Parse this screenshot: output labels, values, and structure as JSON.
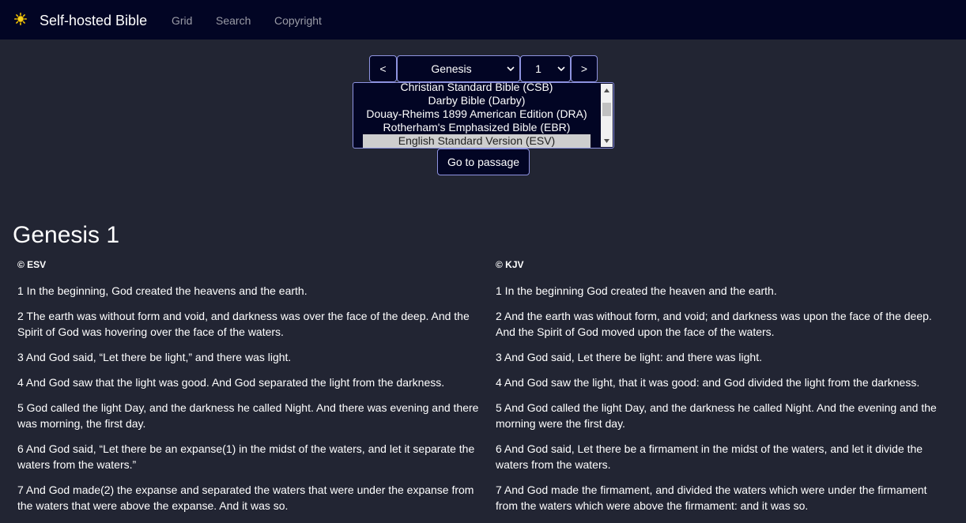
{
  "navbar": {
    "brand": "Self-hosted Bible",
    "brand_icon": "sun-icon",
    "links": [
      "Grid",
      "Search",
      "Copyright"
    ]
  },
  "controls": {
    "prev_label": "<",
    "next_label": ">",
    "book": "Genesis",
    "chapter": "1",
    "versions": [
      "Christian Standard Bible (CSB)",
      "Darby Bible (Darby)",
      "Douay-Rheims 1899 American Edition (DRA)",
      "Rotherham's Emphasized Bible (EBR)",
      "English Standard Version (ESV)"
    ],
    "selected_version": "English Standard Version (ESV)",
    "go_label": "Go to passage"
  },
  "passage": {
    "title": "Genesis 1",
    "columns": [
      {
        "label": "© ESV",
        "verses": [
          "1 In the beginning, God created the heavens and the earth.",
          "2 The earth was without form and void, and darkness was over the face of the deep. And the Spirit of God was hovering over the face of the waters.",
          "3 And God said, “Let there be light,” and there was light.",
          "4 And God saw that the light was good. And God separated the light from the darkness.",
          "5 God called the light Day, and the darkness he called Night. And there was evening and there was morning, the first day.",
          "6 And God said, “Let there be an expanse(1) in the midst of the waters, and let it separate the waters from the waters.”",
          "7 And God made(2) the expanse and separated the waters that were under the expanse from the waters that were above the expanse. And it was so."
        ]
      },
      {
        "label": "© KJV",
        "verses": [
          "1 In the beginning God created the heaven and the earth.",
          "2 And the earth was without form, and void; and darkness was upon the face of the deep. And the Spirit of God moved upon the face of the waters.",
          "3 And God said, Let there be light: and there was light.",
          "4 And God saw the light, that it was good: and God divided the light from the darkness.",
          "5 And God called the light Day, and the darkness he called Night. And the evening and the morning were the first day.",
          "6 And God said, Let there be a firmament in the midst of the waters, and let it divide the waters from the waters.",
          "7 And God made the firmament, and divided the waters which were under the firmament from the waters which were above the firmament: and it was so."
        ]
      }
    ]
  },
  "colors": {
    "navbar_bg": "#020524",
    "page_bg": "#222533",
    "control_border": "#8e93e0",
    "nav_link": "#9a9ba6"
  }
}
